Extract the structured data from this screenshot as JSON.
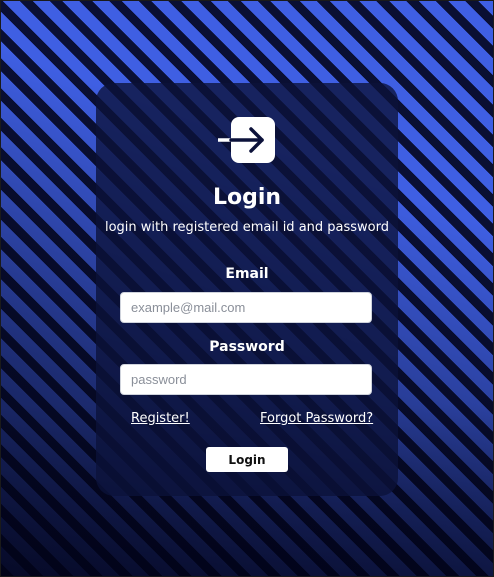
{
  "icon": {
    "name": "login-arrow-icon"
  },
  "card": {
    "title": "Login",
    "subtitle": "login with registered email id and password"
  },
  "email": {
    "label": "Email",
    "placeholder": "example@mail.com",
    "value": ""
  },
  "password": {
    "label": "Password",
    "placeholder": "password",
    "value": ""
  },
  "links": {
    "register": "Register!",
    "forgot": "Forgot Password?"
  },
  "actions": {
    "login_label": "Login"
  },
  "colors": {
    "stripe_dark": "#0a0f33",
    "stripe_light": "#3f5fe3",
    "card_bg": "#0c123a",
    "text": "#ffffff"
  }
}
